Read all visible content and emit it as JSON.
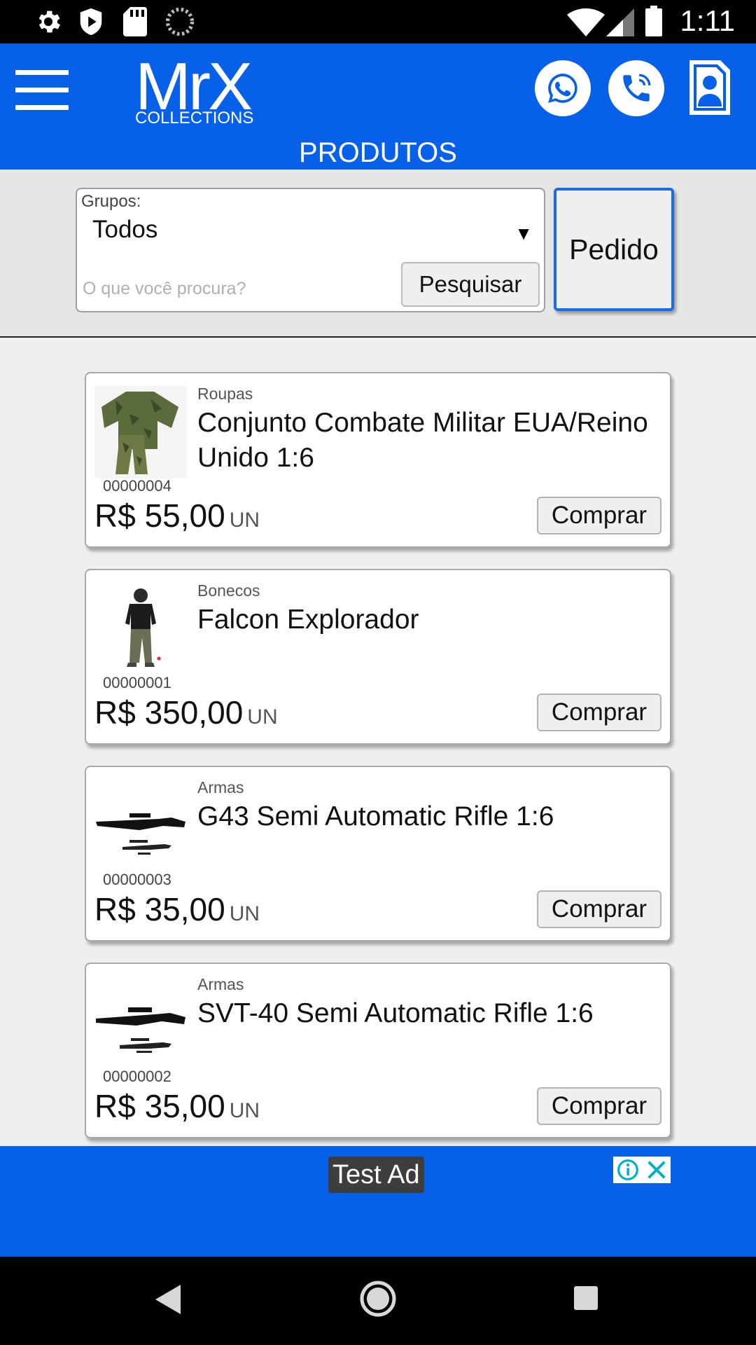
{
  "status_bar": {
    "time": "1:11",
    "left_icons": [
      "gear-icon",
      "shield-icon",
      "sd-card-icon",
      "loading-icon"
    ],
    "right_icons": [
      "wifi-icon",
      "signal-icon",
      "battery-icon"
    ]
  },
  "header": {
    "logo_main": "MrX",
    "logo_sub": "COLLECTIONS",
    "title": "PRODUTOS",
    "accent_color": "#0761e8",
    "buttons": [
      "whatsapp-icon",
      "phone-icon",
      "contact-icon"
    ]
  },
  "filter": {
    "group_label": "Grupos:",
    "group_value": "Todos",
    "search_placeholder": "O que você procura?",
    "search_value": "",
    "search_button": "Pesquisar",
    "order_button": "Pedido"
  },
  "products": [
    {
      "category": "Roupas",
      "name": "Conjunto Combate Militar EUA/Reino Unido 1:6",
      "code": "00000004",
      "price": "R$ 55,00",
      "unit": "UN",
      "buy_label": "Comprar"
    },
    {
      "category": "Bonecos",
      "name": "Falcon Explorador",
      "code": "00000001",
      "price": "R$ 350,00",
      "unit": "UN",
      "buy_label": "Comprar"
    },
    {
      "category": "Armas",
      "name": "G43 Semi Automatic Rifle 1:6",
      "code": "00000003",
      "price": "R$ 35,00",
      "unit": "UN",
      "buy_label": "Comprar"
    },
    {
      "category": "Armas",
      "name": "SVT-40 Semi Automatic Rifle 1:6",
      "code": "00000002",
      "price": "R$ 35,00",
      "unit": "UN",
      "buy_label": "Comprar"
    }
  ],
  "ad": {
    "label": "Test Ad",
    "controls": [
      "info-icon",
      "close-icon"
    ]
  },
  "nav": [
    "back-icon",
    "home-icon",
    "recents-icon"
  ]
}
